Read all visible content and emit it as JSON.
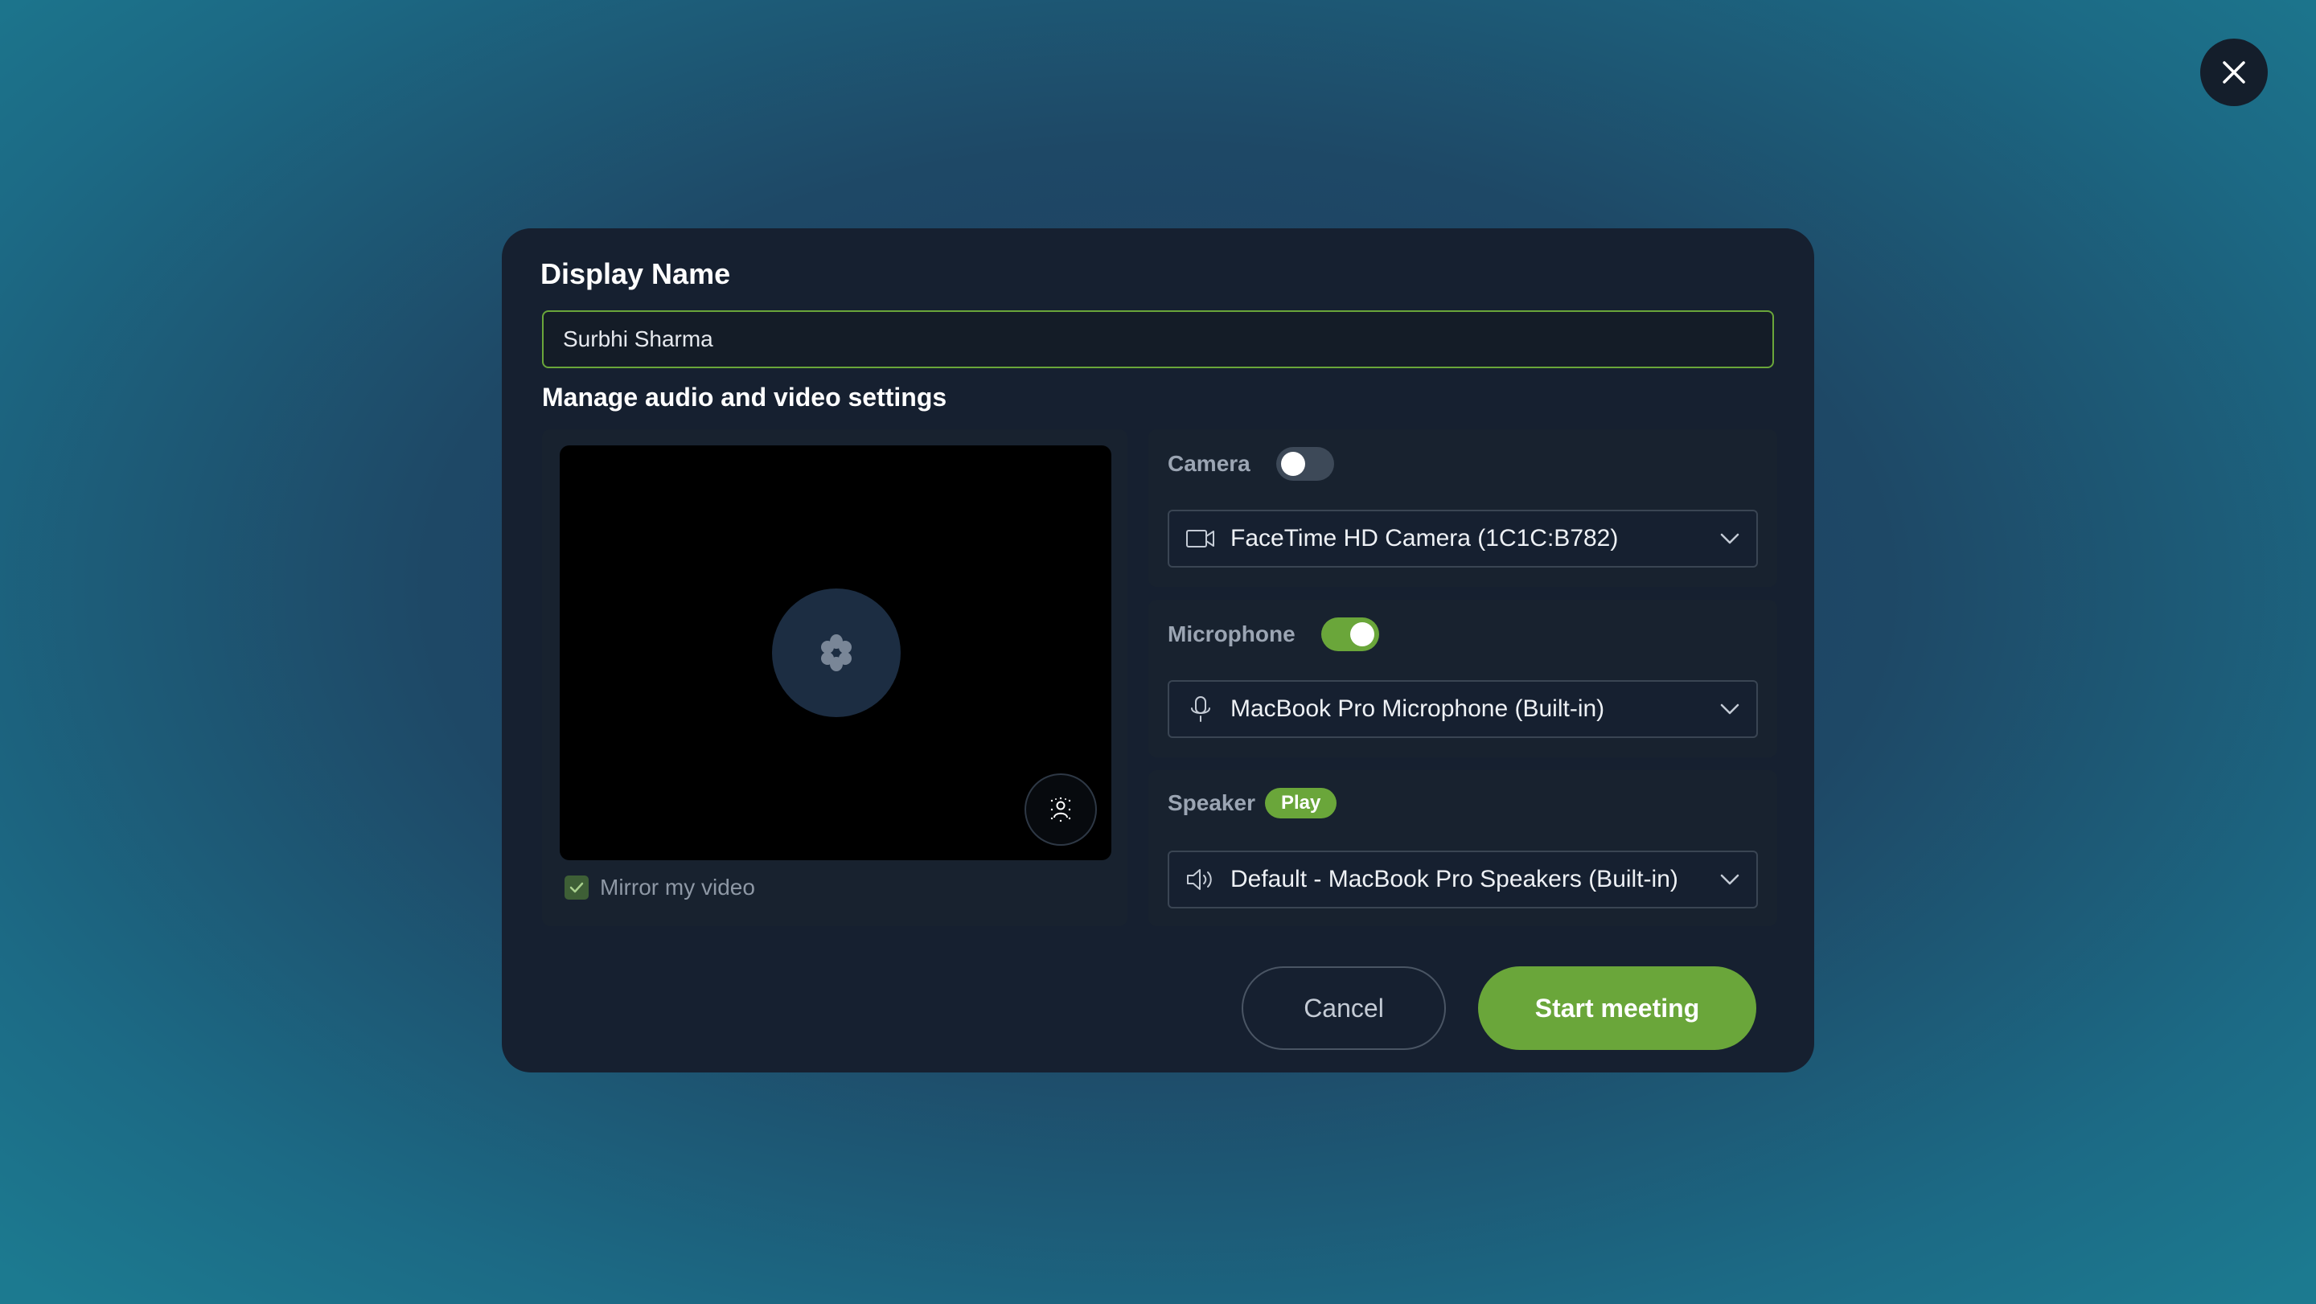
{
  "modal": {
    "title": "Display Name",
    "display_name_value": "Surbhi Sharma",
    "display_name_placeholder": "",
    "subtitle": "Manage audio and video settings"
  },
  "preview": {
    "mirror_label": "Mirror my video",
    "mirror_checked": true
  },
  "camera": {
    "label": "Camera",
    "enabled": false,
    "selected_device": "FaceTime HD Camera (1C1C:B782)",
    "icon": "video-camera-icon"
  },
  "microphone": {
    "label": "Microphone",
    "enabled": true,
    "selected_device": "MacBook Pro Microphone (Built-in)",
    "icon": "microphone-icon"
  },
  "speaker": {
    "label": "Speaker",
    "play_label": "Play",
    "selected_device": "Default - MacBook Pro Speakers (Built-in)",
    "icon": "speaker-icon"
  },
  "actions": {
    "cancel_label": "Cancel",
    "start_label": "Start meeting"
  },
  "colors": {
    "accent": "#6aa63a",
    "modal_bg": "#162030",
    "panel_bg": "#18222f"
  }
}
